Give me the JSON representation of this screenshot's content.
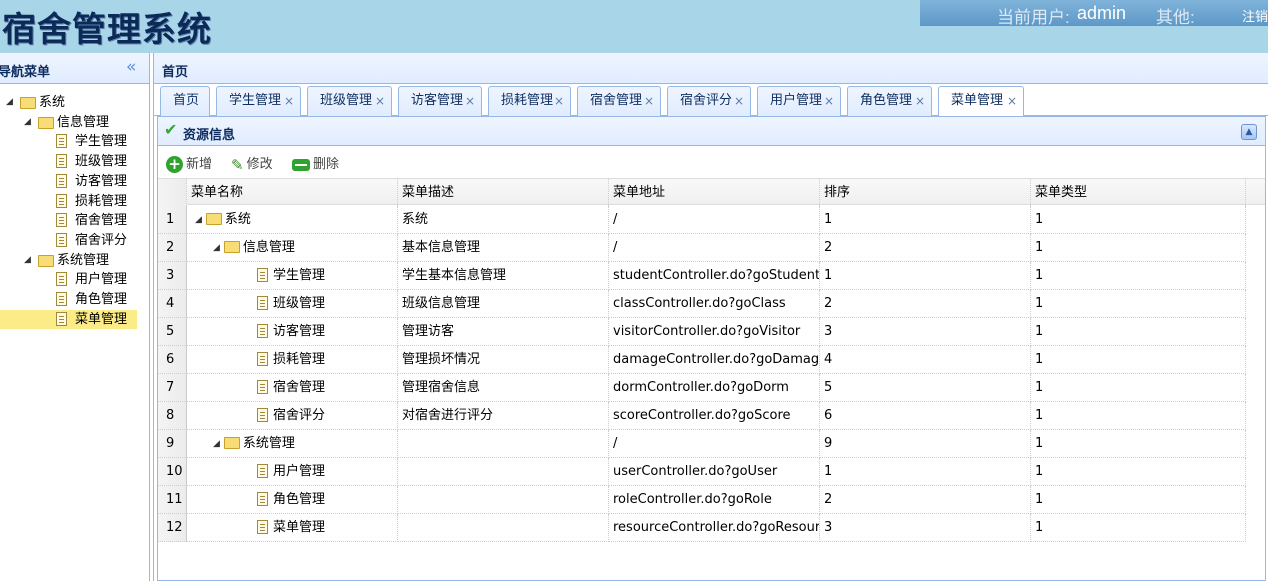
{
  "app": {
    "title": "宿舍管理系统",
    "current_user_label": "当前用户:",
    "current_user": "admin",
    "other_label": "其他:",
    "logout": "注销"
  },
  "nav": {
    "title": "导航菜单",
    "tree": [
      {
        "label": "系统",
        "type": "folder",
        "level": 0
      },
      {
        "label": "信息管理",
        "type": "folder",
        "level": 1
      },
      {
        "label": "学生管理",
        "type": "file",
        "level": 2
      },
      {
        "label": "班级管理",
        "type": "file",
        "level": 2
      },
      {
        "label": "访客管理",
        "type": "file",
        "level": 2
      },
      {
        "label": "损耗管理",
        "type": "file",
        "level": 2
      },
      {
        "label": "宿舍管理",
        "type": "file",
        "level": 2
      },
      {
        "label": "宿舍评分",
        "type": "file",
        "level": 2
      },
      {
        "label": "系统管理",
        "type": "folder",
        "level": 1
      },
      {
        "label": "用户管理",
        "type": "file",
        "level": 2
      },
      {
        "label": "角色管理",
        "type": "file",
        "level": 2
      },
      {
        "label": "菜单管理",
        "type": "file",
        "level": 2,
        "selected": true
      }
    ]
  },
  "main": {
    "title": "首页",
    "tabs": [
      {
        "label": "首页",
        "closable": false
      },
      {
        "label": "学生管理",
        "closable": true
      },
      {
        "label": "班级管理",
        "closable": true
      },
      {
        "label": "访客管理",
        "closable": true
      },
      {
        "label": "损耗管理",
        "closable": true
      },
      {
        "label": "宿舍管理",
        "closable": true
      },
      {
        "label": "宿舍评分",
        "closable": true
      },
      {
        "label": "用户管理",
        "closable": true
      },
      {
        "label": "角色管理",
        "closable": true
      },
      {
        "label": "菜单管理",
        "closable": true,
        "active": true
      }
    ],
    "close_glyph": "×"
  },
  "resource": {
    "title": "资源信息",
    "toolbar": {
      "add": "新增",
      "edit": "修改",
      "delete": "删除"
    },
    "columns": [
      "菜单名称",
      "菜单描述",
      "菜单地址",
      "排序",
      "菜单类型"
    ],
    "rows": [
      {
        "num": "1",
        "name": "系统",
        "kind": "folder",
        "depth": 0,
        "desc": "系统",
        "url": "/",
        "order": "1",
        "type": "1"
      },
      {
        "num": "2",
        "name": "信息管理",
        "kind": "folder",
        "depth": 1,
        "desc": "基本信息管理",
        "url": "/",
        "order": "2",
        "type": "1"
      },
      {
        "num": "3",
        "name": "学生管理",
        "kind": "file",
        "depth": 2,
        "desc": "学生基本信息管理",
        "url": "studentController.do?goStudent",
        "order": "1",
        "type": "1"
      },
      {
        "num": "4",
        "name": "班级管理",
        "kind": "file",
        "depth": 2,
        "desc": "班级信息管理",
        "url": "classController.do?goClass",
        "order": "2",
        "type": "1"
      },
      {
        "num": "5",
        "name": "访客管理",
        "kind": "file",
        "depth": 2,
        "desc": "管理访客",
        "url": "visitorController.do?goVisitor",
        "order": "3",
        "type": "1"
      },
      {
        "num": "6",
        "name": "损耗管理",
        "kind": "file",
        "depth": 2,
        "desc": "管理损坏情况",
        "url": "damageController.do?goDamage",
        "order": "4",
        "type": "1"
      },
      {
        "num": "7",
        "name": "宿舍管理",
        "kind": "file",
        "depth": 2,
        "desc": "管理宿舍信息",
        "url": "dormController.do?goDorm",
        "order": "5",
        "type": "1"
      },
      {
        "num": "8",
        "name": "宿舍评分",
        "kind": "file",
        "depth": 2,
        "desc": "对宿舍进行评分",
        "url": "scoreController.do?goScore",
        "order": "6",
        "type": "1"
      },
      {
        "num": "9",
        "name": "系统管理",
        "kind": "folder",
        "depth": 1,
        "desc": "",
        "url": "/",
        "order": "9",
        "type": "1"
      },
      {
        "num": "10",
        "name": "用户管理",
        "kind": "file",
        "depth": 2,
        "desc": "",
        "url": "userController.do?goUser",
        "order": "1",
        "type": "1"
      },
      {
        "num": "11",
        "name": "角色管理",
        "kind": "file",
        "depth": 2,
        "desc": "",
        "url": "roleController.do?goRole",
        "order": "2",
        "type": "1"
      },
      {
        "num": "12",
        "name": "菜单管理",
        "kind": "file",
        "depth": 2,
        "desc": "",
        "url": "resourceController.do?goResource",
        "order": "3",
        "type": "1"
      }
    ]
  }
}
